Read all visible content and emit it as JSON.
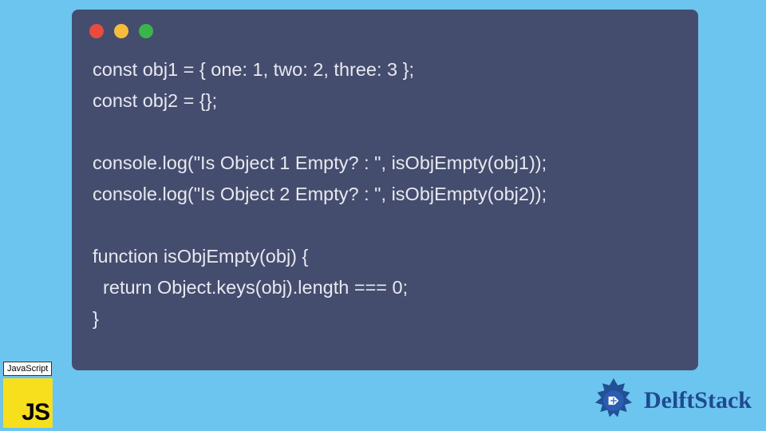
{
  "window": {
    "dots": [
      "red",
      "yellow",
      "green"
    ]
  },
  "code": {
    "lines": [
      "const obj1 = { one: 1, two: 2, three: 3 };",
      "const obj2 = {};",
      "",
      "console.log(\"Is Object 1 Empty? : \", isObjEmpty(obj1));",
      "console.log(\"Is Object 2 Empty? : \", isObjEmpty(obj2));",
      "",
      "function isObjEmpty(obj) {",
      "  return Object.keys(obj).length === 0;",
      "}"
    ]
  },
  "badge": {
    "label": "JavaScript",
    "logo_text": "JS"
  },
  "brand": {
    "name": "DelftStack",
    "accent": "#204a8f"
  }
}
